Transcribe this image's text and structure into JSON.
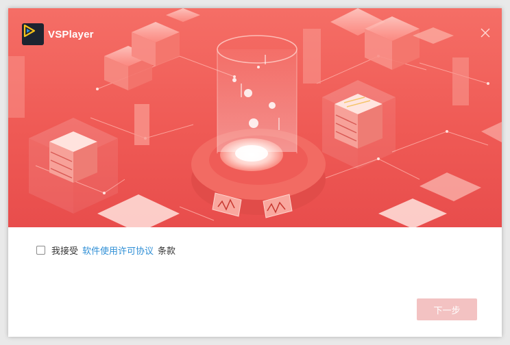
{
  "app": {
    "title": "VSPlayer",
    "logo_icon": "play-triangle-icon",
    "close_icon": "close-icon"
  },
  "agreement": {
    "prefix": "我接受",
    "link": "软件使用许可协议",
    "suffix": "条款",
    "checked": false
  },
  "footer": {
    "next_label": "下一步",
    "next_enabled": false
  },
  "colors": {
    "banner": "#ef5a55",
    "link": "#2f8fd6",
    "next_disabled": "#f3c2c2",
    "logo_bg": "#1d2430",
    "logo_accent": "#f6c21b"
  }
}
